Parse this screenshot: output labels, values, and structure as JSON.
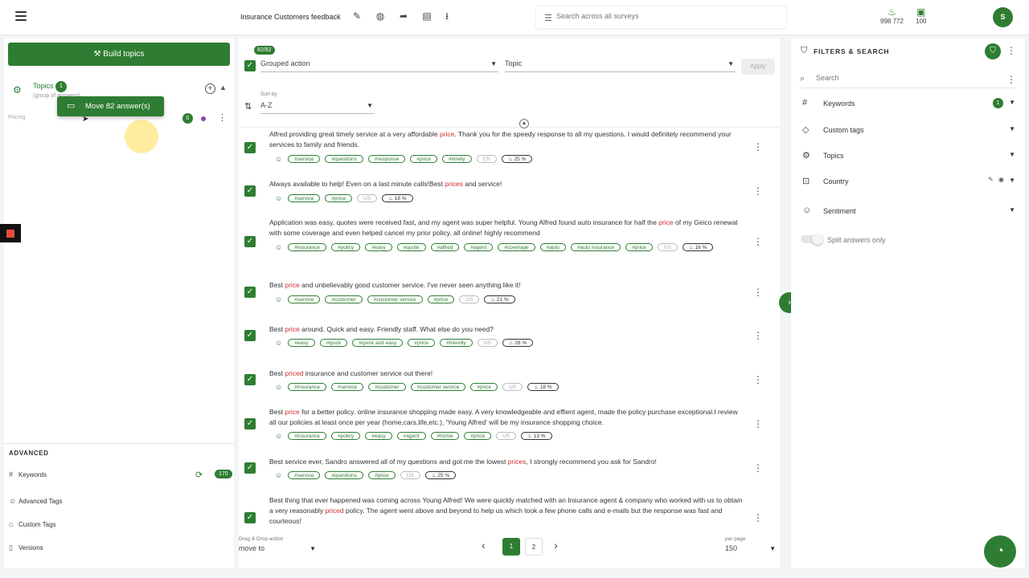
{
  "header": {
    "title": "Insurance Customers feedback",
    "search_placeholder": "Search across all surveys",
    "credits_value": "998 772",
    "saved_value": "100",
    "avatar_initial": "S"
  },
  "left": {
    "build_topics_label": "Build topics",
    "topics_label": "Topics",
    "topics_badge": "1",
    "topics_sub": "(group of answers)",
    "move_tip": "Move 82 answer(s)",
    "pricing_label": "Pricing",
    "pricing_count": "0",
    "advanced_title": "ADVANCED",
    "advanced_items": [
      {
        "label": "Keywords",
        "count": "170"
      },
      {
        "label": "Advanced Tags"
      },
      {
        "label": "Custom Tags"
      },
      {
        "label": "Versions"
      }
    ]
  },
  "center": {
    "count_badge": "82/82",
    "grouped_action": "Grouped action",
    "topic_select": "Topic",
    "apply_label": "Apply",
    "sort_label": "Sort by",
    "sort_value": "A-Z",
    "rows": [
      {
        "pre": "Alfred providing great timely service at a very affordable ",
        "hl": "price",
        "post": ". Thank you for the speedy response to all my questions. I would definitely recommend your services to family and friends.",
        "tags": [
          "#service",
          "#questions",
          "#response",
          "#price",
          "#timely"
        ],
        "country": "CR",
        "pct": "25 %"
      },
      {
        "pre": "Always available to help! Even on a last minute calls!Best ",
        "hl": "prices",
        "post": " and service!",
        "tags": [
          "#service",
          "#price"
        ],
        "country": "US",
        "pct": "18 %"
      },
      {
        "pre": "Application was easy, quotes were received fast, and my agent was super helpful. Young Alfred found auto insurance for half the ",
        "hl": "price",
        "post": " of my Geico renewal with some coverage and even helped cancel my prior policy. all online! highly recommend",
        "tags": [
          "#insurance",
          "#policy",
          "#easy",
          "#quote",
          "#alfred",
          "#agent",
          "#coverage",
          "#auto",
          "#auto insurance",
          "#price"
        ],
        "country": "US",
        "pct": "16 %"
      },
      {
        "pre": "Best ",
        "hl": "price",
        "post": " and unbelievably good customer service. I've never seen anything like it!",
        "tags": [
          "#service",
          "#customer",
          "#customer service",
          "#price"
        ],
        "country": "US",
        "pct": "21 %"
      },
      {
        "pre": "Best ",
        "hl": "price",
        "post": " around. Quick and easy. Friendly staff. What else do you need?",
        "tags": [
          "#easy",
          "#quick",
          "#quick and easy",
          "#price",
          "#friendly"
        ],
        "country": "US",
        "pct": "28 %"
      },
      {
        "pre": "Best ",
        "hl": "priced",
        "post": " insurance and customer service out there!",
        "tags": [
          "#insurance",
          "#service",
          "#customer",
          "#customer service",
          "#price"
        ],
        "country": "US",
        "pct": "18 %"
      },
      {
        "pre": "Best ",
        "hl": "price",
        "post": " for a better policy. online insurance shopping made easy. A very knowledgeable and effient agent, made the policy purchase exceptional.I review all our policies at least once per year (home,cars,life,etc.), 'Young Alfred' will be my insurance shopping choice.",
        "tags": [
          "#insurance",
          "#policy",
          "#easy",
          "#agent",
          "#home",
          "#price"
        ],
        "country": "US",
        "pct": "13 %"
      },
      {
        "pre": "Best service ever, Sandro answered all of my questions and got me the lowest ",
        "hl": "prices",
        "post": ", I strongly recommend you ask for Sandro!",
        "tags": [
          "#service",
          "#questions",
          "#price"
        ],
        "country": "US",
        "pct": "25 %"
      },
      {
        "pre": "Best thing that ever happened was coming across Young Alfred! We were quickly matched with an Insurance agent & company who worked with us to obtain a very reasonably ",
        "hl": "priced",
        "post": " policy. The agent went above and beyond to help us which took a few phone calls and e-mails but the response was fast and courteous!",
        "tags": [],
        "country": "",
        "pct": ""
      }
    ],
    "drag_drop_label": "Drag & Drop action",
    "drag_drop_value": "move to",
    "pages": [
      "1",
      "2"
    ],
    "per_page_label": "per page",
    "per_page_value": "150"
  },
  "right": {
    "title": "FILTERS & SEARCH",
    "search_placeholder": "Search",
    "facets": [
      {
        "label": "Keywords",
        "badge": "1"
      },
      {
        "label": "Custom tags"
      },
      {
        "label": "Topics"
      },
      {
        "label": "Country"
      },
      {
        "label": "Sentiment"
      }
    ],
    "split_label": "Split answers only"
  },
  "colors": {
    "accent": "#2e7d32",
    "highlight": "#d32f2f"
  }
}
